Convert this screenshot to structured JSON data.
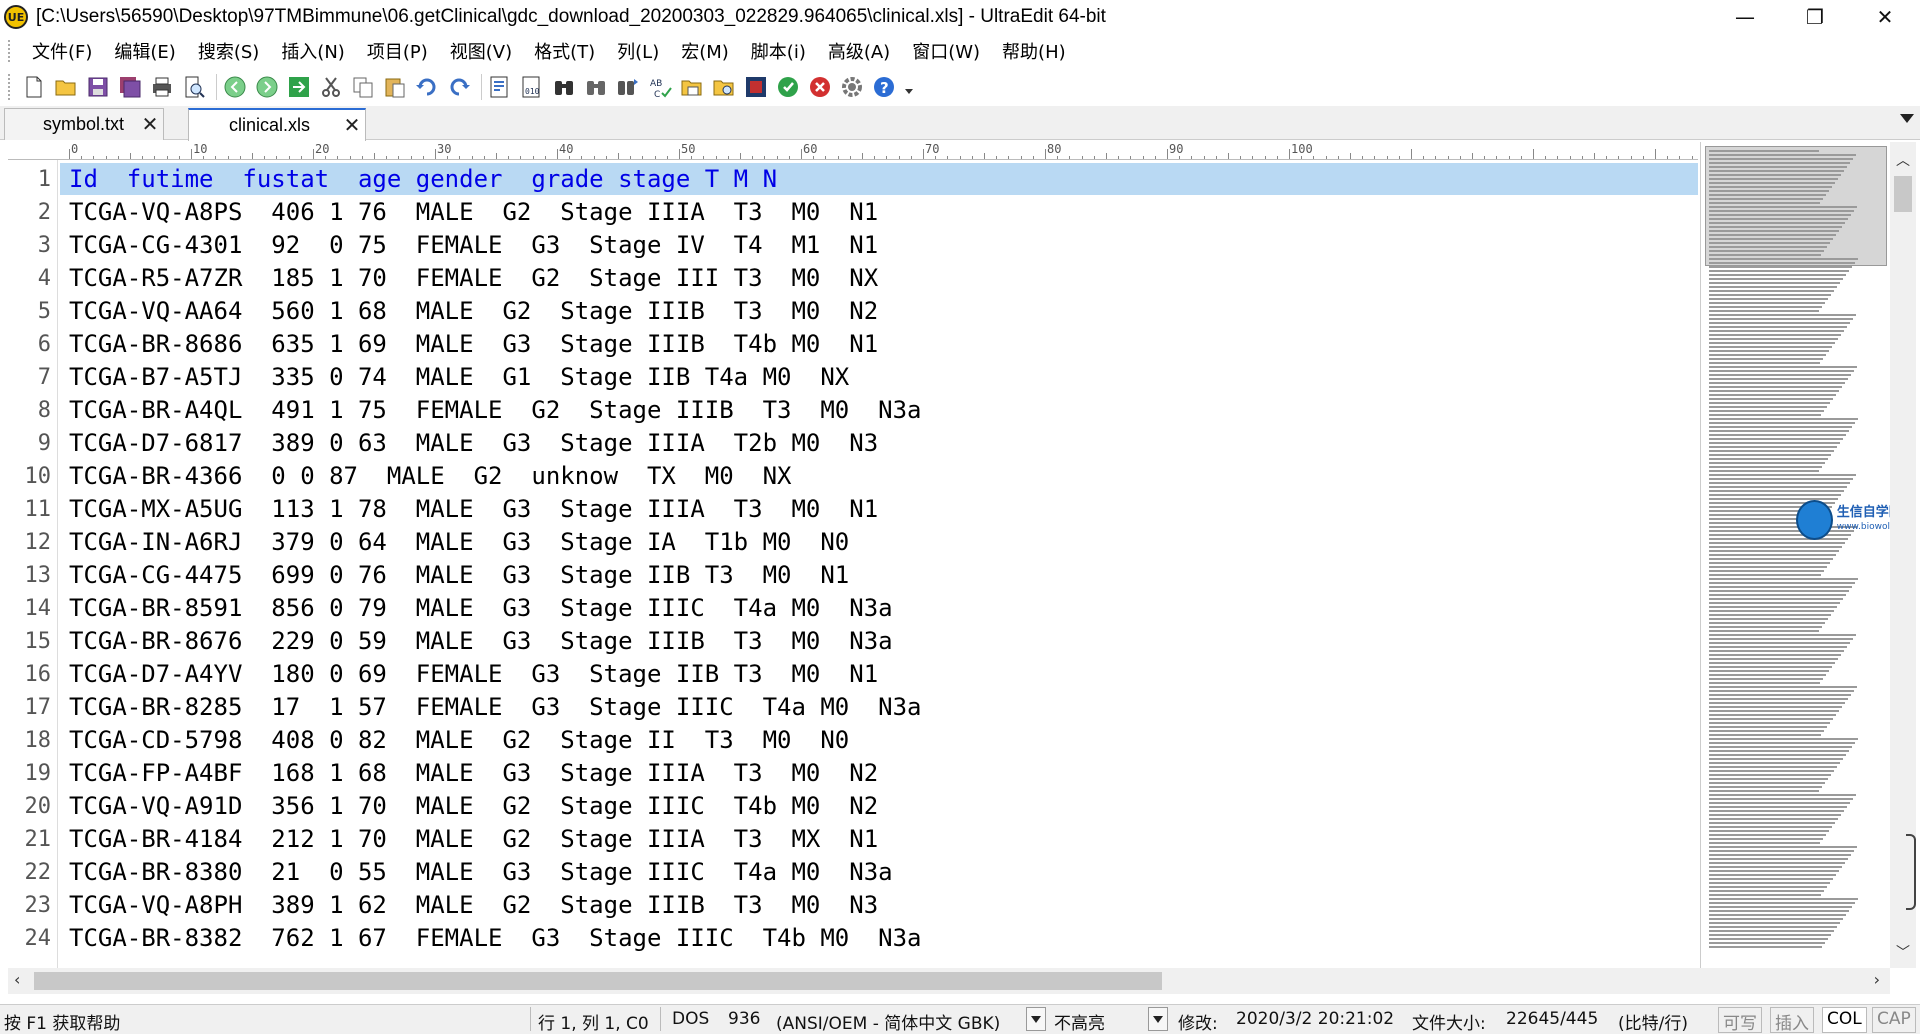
{
  "window": {
    "title": "[C:\\Users\\56590\\Desktop\\97TMBimmune\\06.getClinical\\gdc_download_20200303_022829.964065\\clinical.xls] - UltraEdit 64-bit",
    "app_icon_label": "UE",
    "minimize_glyph": "—",
    "restore_glyph": "❐",
    "close_glyph": "✕"
  },
  "menu": [
    "文件(F)",
    "编辑(E)",
    "搜索(S)",
    "插入(N)",
    "项目(P)",
    "视图(V)",
    "格式(T)",
    "列(L)",
    "宏(M)",
    "脚本(i)",
    "高级(A)",
    "窗口(W)",
    "帮助(H)"
  ],
  "toolbar_icons": [
    "new-file-icon",
    "open-folder-icon",
    "save-icon",
    "save-all-icon",
    "print-icon",
    "print-preview-icon",
    "back-icon",
    "forward-icon",
    "goto-icon",
    "cut-icon",
    "copy-icon",
    "paste-icon",
    "undo-icon",
    "redo-icon",
    "hex-edit-icon",
    "binary-icon",
    "find-icon",
    "find-next-icon",
    "replace-icon",
    "spell-check-icon",
    "file-compare-icon",
    "file-explorer-icon",
    "script-icon",
    "run-icon",
    "stop-icon",
    "settings-icon",
    "help-icon"
  ],
  "tabs": [
    {
      "label": "symbol.txt",
      "close": "✕"
    },
    {
      "label": "clinical.xls",
      "close": "✕"
    }
  ],
  "ruler": {
    "labels": [
      "0",
      "10",
      "20",
      "30",
      "40",
      "50",
      "60",
      "70",
      "80",
      "90",
      "100"
    ]
  },
  "editor": {
    "lines": [
      "Id  futime  fustat  age gender  grade stage T M N",
      "TCGA-VQ-A8PS  406 1 76  MALE  G2  Stage IIIA  T3  M0  N1",
      "TCGA-CG-4301  92  0 75  FEMALE  G3  Stage IV  T4  M1  N1",
      "TCGA-R5-A7ZR  185 1 70  FEMALE  G2  Stage III T3  M0  NX",
      "TCGA-VQ-AA64  560 1 68  MALE  G2  Stage IIIB  T3  M0  N2",
      "TCGA-BR-8686  635 1 69  MALE  G3  Stage IIIB  T4b M0  N1",
      "TCGA-B7-A5TJ  335 0 74  MALE  G1  Stage IIB T4a M0  NX",
      "TCGA-BR-A4QL  491 1 75  FEMALE  G2  Stage IIIB  T3  M0  N3a",
      "TCGA-D7-6817  389 0 63  MALE  G3  Stage IIIA  T2b M0  N3",
      "TCGA-BR-4366  0 0 87  MALE  G2  unknow  TX  M0  NX",
      "TCGA-MX-A5UG  113 1 78  MALE  G3  Stage IIIA  T3  M0  N1",
      "TCGA-IN-A6RJ  379 0 64  MALE  G3  Stage IA  T1b M0  N0",
      "TCGA-CG-4475  699 0 76  MALE  G3  Stage IIB T3  M0  N1",
      "TCGA-BR-8591  856 0 79  MALE  G3  Stage IIIC  T4a M0  N3a",
      "TCGA-BR-8676  229 0 59  MALE  G3  Stage IIIB  T3  M0  N3a",
      "TCGA-D7-A4YV  180 0 69  FEMALE  G3  Stage IIB T3  M0  N1",
      "TCGA-BR-8285  17  1 57  FEMALE  G3  Stage IIIC  T4a M0  N3a",
      "TCGA-CD-5798  408 0 82  MALE  G2  Stage II  T3  M0  N0",
      "TCGA-FP-A4BF  168 1 68  MALE  G3  Stage IIIA  T3  M0  N2",
      "TCGA-VQ-A91D  356 1 70  MALE  G2  Stage IIIC  T4b M0  N2",
      "TCGA-BR-4184  212 1 70  MALE  G2  Stage IIIA  T3  MX  N1",
      "TCGA-BR-8380  21  0 55  MALE  G3  Stage IIIC  T4a M0  N3a",
      "TCGA-VQ-A8PH  389 1 62  MALE  G2  Stage IIIB  T3  M0  N3",
      "TCGA-BR-8382  762 1 67  FEMALE  G3  Stage IIIC  T4b M0  N3a"
    ]
  },
  "watermark": {
    "name": "生信自学网",
    "url": "www.biowolf.cn"
  },
  "status": {
    "help": "按 F1 获取帮助",
    "position": "行 1, 列 1, C0",
    "line_ending": "DOS",
    "codepage": "936",
    "encoding": "(ANSI/OEM - 简体中文 GBK)",
    "highlight": "不高亮",
    "modified": "修改:",
    "modified_time": "2020/3/2 20:21:02",
    "file_size_label": "文件大小:",
    "file_size": "22645/445",
    "size_unit": "(比特/行)",
    "writable": "可写",
    "insert": "插入",
    "col": "COL",
    "cap": "CAP"
  }
}
